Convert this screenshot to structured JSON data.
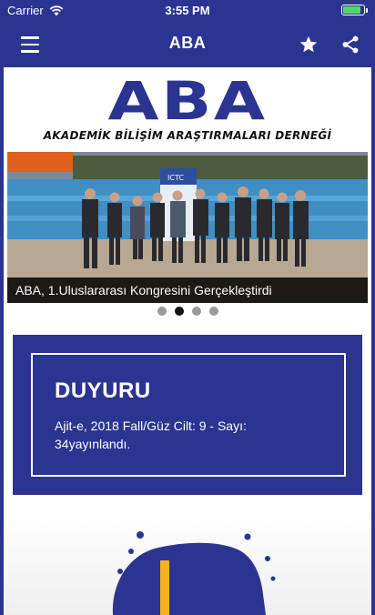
{
  "status_bar": {
    "carrier": "Carrier",
    "time": "3:55 PM",
    "battery_level": 0.85,
    "battery_color": "#4cd964"
  },
  "nav": {
    "title": "ABA",
    "menu_icon": "hamburger-icon",
    "favorite_icon": "star-icon",
    "share_icon": "share-icon",
    "bg_color": "#2b3591"
  },
  "logo": {
    "main": "ABA",
    "subtitle": "AKADEMİK BİLİŞİM ARAŞTIRMALARI DERNEĞİ"
  },
  "slider": {
    "caption": "ABA, 1.Uluslararası Kongresini Gerçekleştirdi",
    "slide_count": 4,
    "active_index": 1,
    "banner_text": "ICTC"
  },
  "announcement": {
    "title": "DUYURU",
    "text": "Ajit-e, 2018 Fall/Güz Cilt: 9 - Sayı: 34yayınlandı."
  },
  "colors": {
    "brand": "#2b3591",
    "dot_inactive": "#9a9a9a",
    "dot_active": "#111111"
  }
}
